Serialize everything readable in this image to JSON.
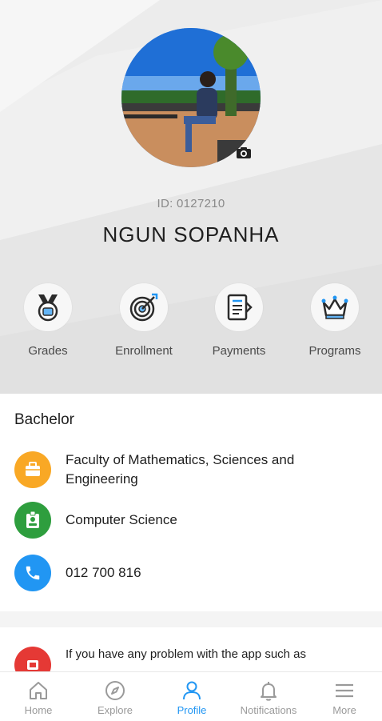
{
  "profile": {
    "id_text": "ID: 0127210",
    "name": "NGUN SOPANHA"
  },
  "quick_actions": [
    {
      "label": "Grades",
      "icon": "medal-icon"
    },
    {
      "label": "Enrollment",
      "icon": "target-icon"
    },
    {
      "label": "Payments",
      "icon": "invoice-icon"
    },
    {
      "label": "Programs",
      "icon": "crown-icon"
    }
  ],
  "program": {
    "title": "Bachelor",
    "rows": [
      {
        "text": "Faculty of Mathematics, Sciences and Engineering",
        "icon": "briefcase-icon",
        "color": "#f9a825"
      },
      {
        "text": "Computer Science",
        "icon": "id-badge-icon",
        "color": "#2e9e3e"
      },
      {
        "text": "012 700 816",
        "icon": "phone-icon",
        "color": "#2196f3"
      }
    ]
  },
  "notice": {
    "text": "If you have any problem with the app such as"
  },
  "bottom_nav": [
    {
      "label": "Home",
      "icon": "home-icon",
      "active": false
    },
    {
      "label": "Explore",
      "icon": "compass-icon",
      "active": false
    },
    {
      "label": "Profile",
      "icon": "person-icon",
      "active": true
    },
    {
      "label": "Notifications",
      "icon": "bell-icon",
      "active": false
    },
    {
      "label": "More",
      "icon": "menu-icon",
      "active": false
    }
  ],
  "colors": {
    "accent": "#2196f3",
    "inactive": "#9a9a9a",
    "danger": "#e53935"
  }
}
